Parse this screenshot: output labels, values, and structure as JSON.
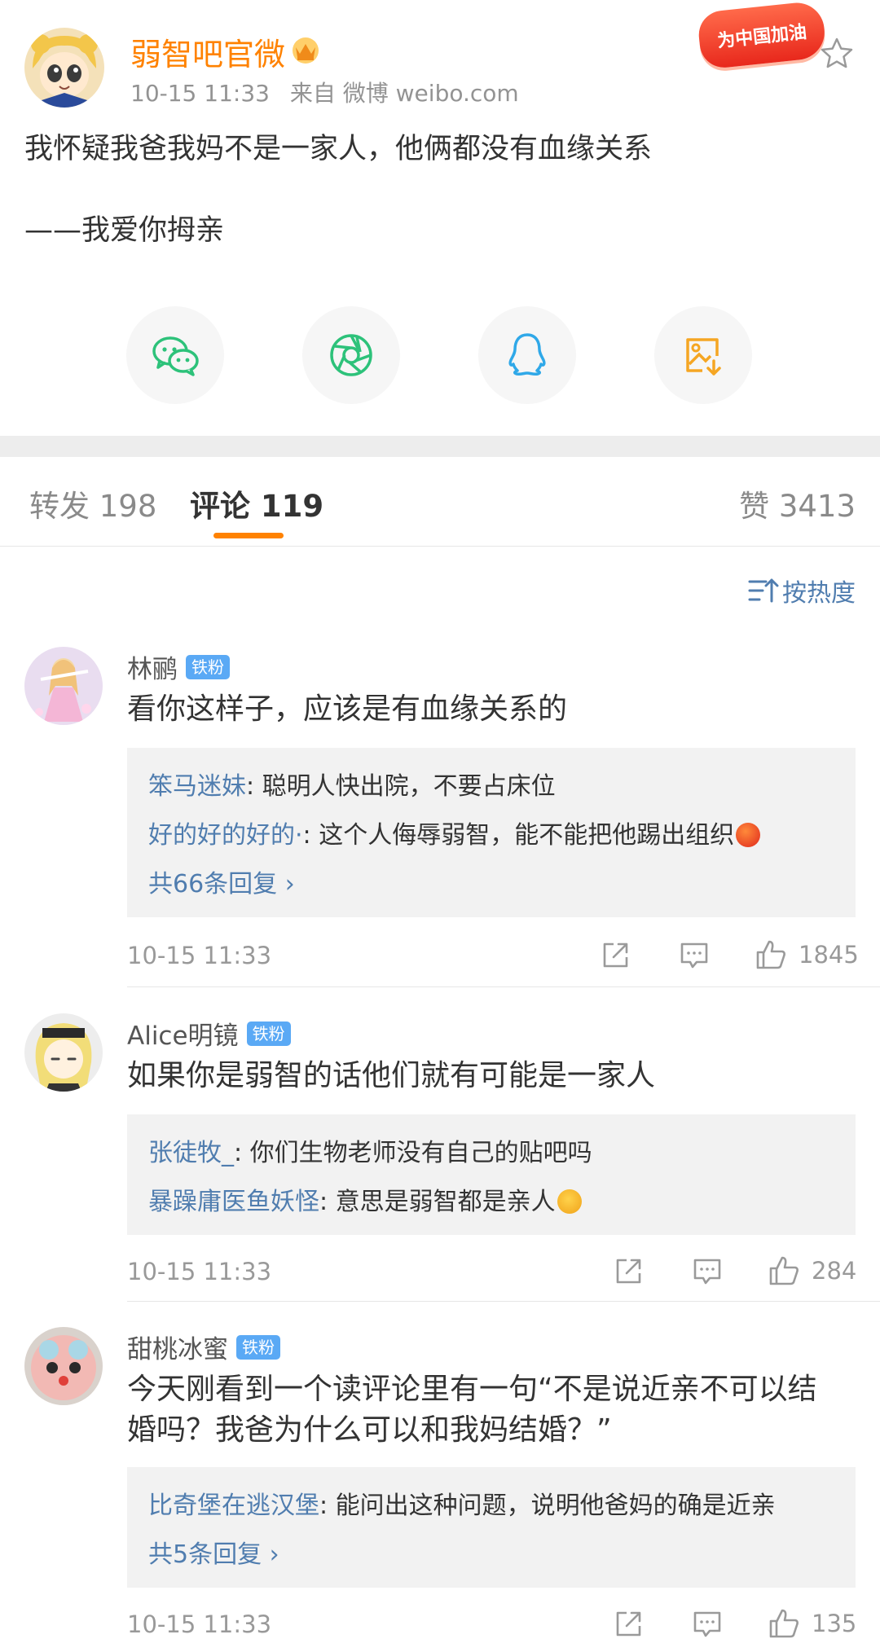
{
  "post": {
    "author": "弱智吧官微",
    "time": "10-15 11:33",
    "source": "来自 微博 weibo.com",
    "promo_badge": "为中国加油",
    "text": "我怀疑我爸我妈不是一家人，他俩都没有血缘关系",
    "signature": "——我爱你拇亲",
    "share_targets": [
      "wechat-icon",
      "moments-icon",
      "qq-icon",
      "save-image-icon"
    ]
  },
  "tabs": {
    "repost": "转发 198",
    "comments": "评论 119",
    "likes": "赞 3413"
  },
  "sort_label": "按热度",
  "comments": [
    {
      "user": "林鹂",
      "badge": "铁粉",
      "text": "看你这样子，应该是有血缘关系的",
      "replies": [
        {
          "user": "笨马迷妹",
          "sep": ": ",
          "text": "聪明人快出院，不要占床位"
        },
        {
          "user": "好的好的好的·",
          "sep": ": ",
          "text": "这个人侮辱弱智，能不能把他踢出组织"
        }
      ],
      "more": "共66条回复 ›",
      "time": "10-15 11:33",
      "likes": "1845"
    },
    {
      "user": "Alice明镜",
      "badge": "铁粉",
      "text": "如果你是弱智的话他们就有可能是一家人",
      "replies": [
        {
          "user": "张徒牧_",
          "sep": ": ",
          "text": "你们生物老师没有自己的贴吧吗"
        },
        {
          "user": "暴躁庸医鱼妖怪",
          "sep": ": ",
          "text": "意思是弱智都是亲人"
        }
      ],
      "time": "10-15 11:33",
      "likes": "284"
    },
    {
      "user": "甜桃冰蜜",
      "badge": "铁粉",
      "text_line1": "今天刚看到一个读评论里有一句“不是说近亲不可以结",
      "text_line2": "婚吗？我爸为什么可以和我妈结婚？”",
      "replies": [
        {
          "user": "比奇堡在逃汉堡",
          "sep": ": ",
          "text": "能问出这种问题，说明他爸妈的确是近亲"
        }
      ],
      "more": "共5条回复 ›",
      "time": "10-15 11:33",
      "likes": "135"
    }
  ],
  "colors": {
    "accent_orange": "#ff8200",
    "link_blue": "#507daf",
    "badge_blue": "#5aa9f5",
    "wechat_green": "#2dc27a",
    "qq_blue": "#2fa8e8",
    "save_orange": "#f5a623"
  }
}
